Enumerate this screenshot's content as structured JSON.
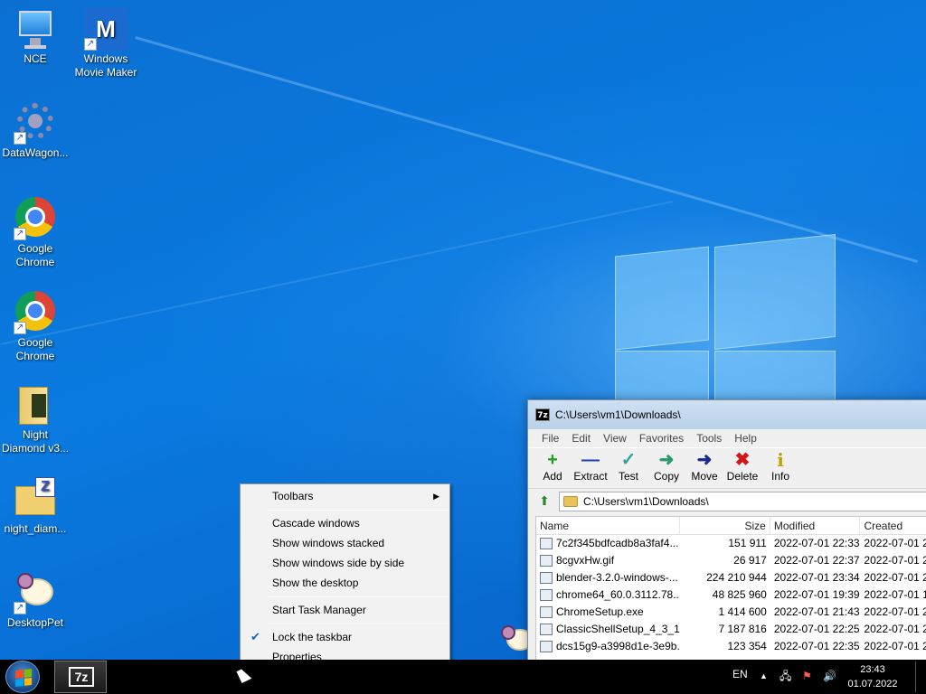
{
  "desktop": {
    "icons": [
      {
        "label": "NCE"
      },
      {
        "label": "Windows Movie Maker"
      },
      {
        "label": "DataWagon..."
      },
      {
        "label": "Google Chrome"
      },
      {
        "label": "Google Chrome"
      },
      {
        "label": "Night Diamond v3..."
      },
      {
        "label": "night_diam..."
      },
      {
        "label": "DesktopPet"
      }
    ]
  },
  "sevenzip": {
    "title": "C:\\Users\\vm1\\Downloads\\",
    "icon_text": "7z",
    "menu": [
      "File",
      "Edit",
      "View",
      "Favorites",
      "Tools",
      "Help"
    ],
    "toolbar": [
      {
        "label": "Add",
        "glyph": "+",
        "color": "#1aa31a"
      },
      {
        "label": "Extract",
        "glyph": "—",
        "color": "#1a3fb8"
      },
      {
        "label": "Test",
        "glyph": "✓",
        "color": "#2aa6a0"
      },
      {
        "label": "Copy",
        "glyph": "➜",
        "color": "#2a9a6a"
      },
      {
        "label": "Move",
        "glyph": "➜",
        "color": "#1a2a8a"
      },
      {
        "label": "Delete",
        "glyph": "✖",
        "color": "#d01818"
      },
      {
        "label": "Info",
        "glyph": "i",
        "color": "#c8a000"
      }
    ],
    "address": "C:\\Users\\vm1\\Downloads\\",
    "columns": {
      "name": "Name",
      "size": "Size",
      "modified": "Modified",
      "created": "Created"
    },
    "files": [
      {
        "name": "7c2f345bdfcadb8a3faf4...",
        "size": "151 911",
        "modified": "2022-07-01 22:33",
        "created": "2022-07-01 2"
      },
      {
        "name": "8cgvxHw.gif",
        "size": "26 917",
        "modified": "2022-07-01 22:37",
        "created": "2022-07-01 2"
      },
      {
        "name": "blender-3.2.0-windows-...",
        "size": "224 210 944",
        "modified": "2022-07-01 23:34",
        "created": "2022-07-01 2"
      },
      {
        "name": "chrome64_60.0.3112.78....",
        "size": "48 825 960",
        "modified": "2022-07-01 19:39",
        "created": "2022-07-01 1"
      },
      {
        "name": "ChromeSetup.exe",
        "size": "1 414 600",
        "modified": "2022-07-01 21:43",
        "created": "2022-07-01 2"
      },
      {
        "name": "ClassicShellSetup_4_3_1....",
        "size": "7 187 816",
        "modified": "2022-07-01 22:25",
        "created": "2022-07-01 2"
      },
      {
        "name": "dcs15g9-a3998d1e-3e9b...",
        "size": "123 354",
        "modified": "2022-07-01 22:35",
        "created": "2022-07-01 2"
      }
    ]
  },
  "context_menu": {
    "toolbars": "Toolbars",
    "cascade": "Cascade windows",
    "stacked": "Show windows stacked",
    "side_by_side": "Show windows side by side",
    "show_desktop": "Show the desktop",
    "task_manager": "Start Task Manager",
    "lock_taskbar": "Lock the taskbar",
    "properties": "Properties"
  },
  "taskbar": {
    "app_label": "7z",
    "language": "EN",
    "time": "23:43",
    "date": "01.07.2022"
  }
}
